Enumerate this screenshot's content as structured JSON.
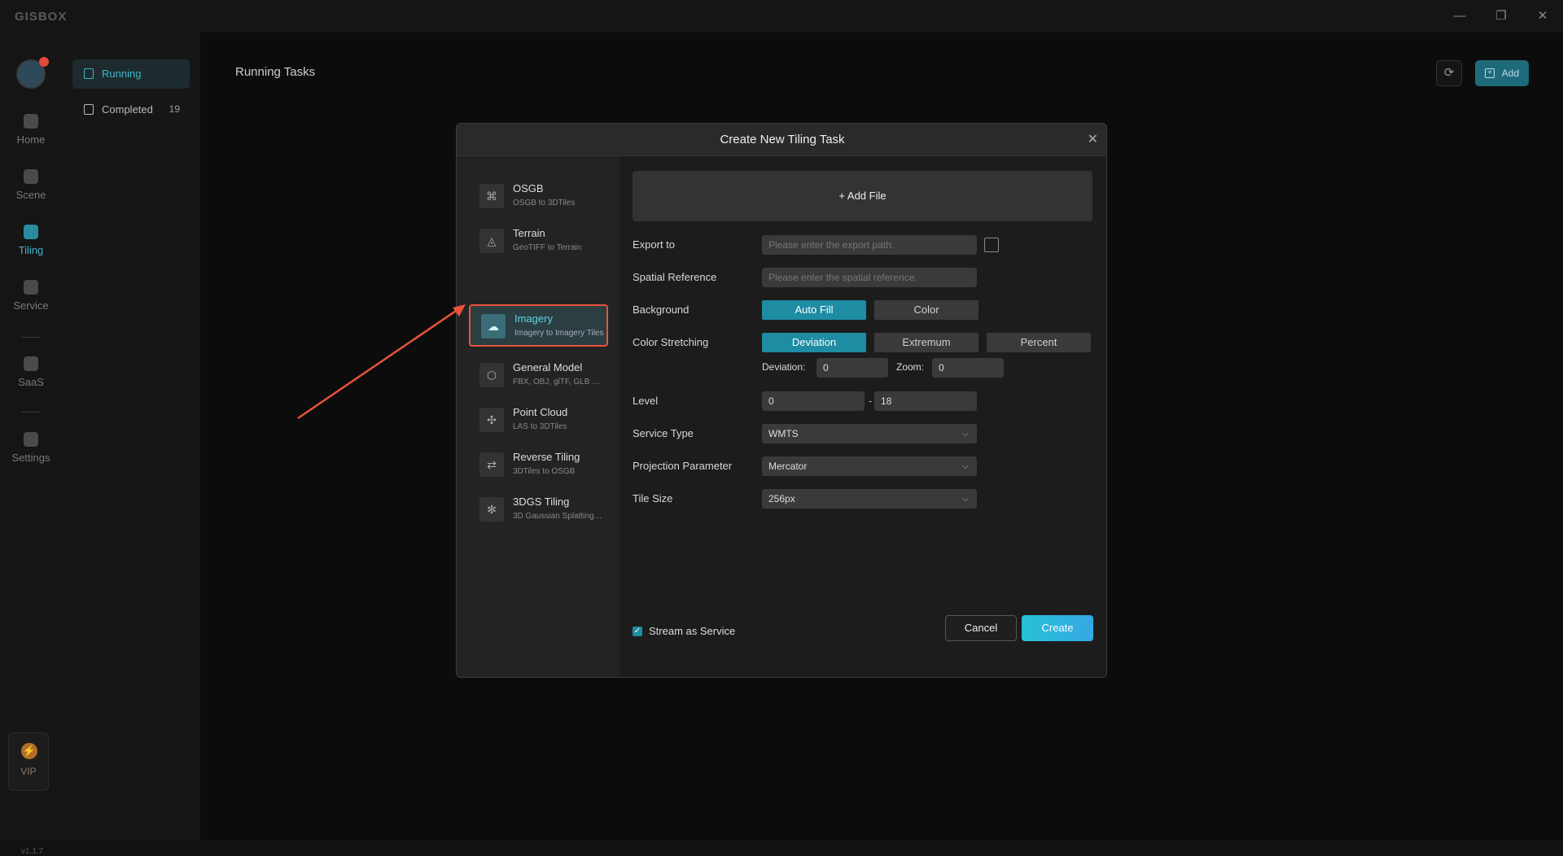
{
  "app": {
    "logo": "GISBOX",
    "version": "v1.1.7"
  },
  "window_controls": {
    "minimize": "—",
    "restore": "❐",
    "close": "✕"
  },
  "nav": {
    "items": [
      {
        "label": "Home",
        "icon": "home-icon"
      },
      {
        "label": "Scene",
        "icon": "scene-icon"
      },
      {
        "label": "Tiling",
        "icon": "tiling-icon"
      },
      {
        "label": "Service",
        "icon": "service-icon"
      },
      {
        "label": "SaaS",
        "icon": "saas-icon"
      },
      {
        "label": "Settings",
        "icon": "settings-icon"
      }
    ],
    "active": "Tiling",
    "vip_label": "VIP",
    "vip_icon": "⚡"
  },
  "tasks": {
    "running_label": "Running",
    "completed_label": "Completed",
    "completed_count": "19"
  },
  "main": {
    "title": "Running Tasks",
    "refresh_icon": "⟳",
    "add_label": "Add",
    "add_icon": "+"
  },
  "dialog": {
    "title": "Create New Tiling Task",
    "close_icon": "✕",
    "types": [
      {
        "name": "OSGB",
        "sub": "OSGB to 3DTiles",
        "icon": "⌘"
      },
      {
        "name": "Terrain",
        "sub": "GeoTIFF to Terrain",
        "icon": "◬"
      },
      {
        "name": "Imagery",
        "sub": "Imagery to Imagery Tiles",
        "icon": "☁"
      },
      {
        "name": "General Model",
        "sub": "FBX, OBJ, glTF, GLB to 3DTiles",
        "icon": "⬡"
      },
      {
        "name": "Point Cloud",
        "sub": "LAS to 3DTiles",
        "icon": "✣"
      },
      {
        "name": "Reverse Tiling",
        "sub": "3DTiles to OSGB",
        "icon": "⇄"
      },
      {
        "name": "3DGS Tiling",
        "sub": "3D Gaussian Splatting to 3DTiles",
        "icon": "✻"
      }
    ],
    "active_type": "Imagery",
    "add_file_label": "+ Add File",
    "export_label": "Export to",
    "export_placeholder": "Please enter the export path.",
    "spatial_label": "Spatial Reference",
    "spatial_placeholder": "Please enter the spatial reference.",
    "background_label": "Background",
    "background_options": [
      "Auto Fill",
      "Color"
    ],
    "stretch_label": "Color Stretching",
    "stretch_options": [
      "Deviation",
      "Extremum",
      "Percent"
    ],
    "deviation_label": "Deviation:",
    "deviation_value": "0",
    "zoom_label": "Zoom:",
    "zoom_value": "0",
    "level_label": "Level",
    "level_min": "0",
    "level_sep": "-",
    "level_max": "18",
    "service_type_label": "Service Type",
    "service_type_value": "WMTS",
    "projection_label": "Projection Parameter",
    "projection_value": "Mercator",
    "tile_size_label": "Tile Size",
    "tile_size_value": "256px",
    "chevron": "⌵",
    "stream_label": "Stream as Service",
    "stream_checked": true,
    "check_mark": "✓",
    "cancel_label": "Cancel",
    "create_label": "Create"
  },
  "colors": {
    "accent": "#1e8ca3",
    "highlight_border": "#e8533a",
    "annotation_arrow": "#e8533a"
  }
}
